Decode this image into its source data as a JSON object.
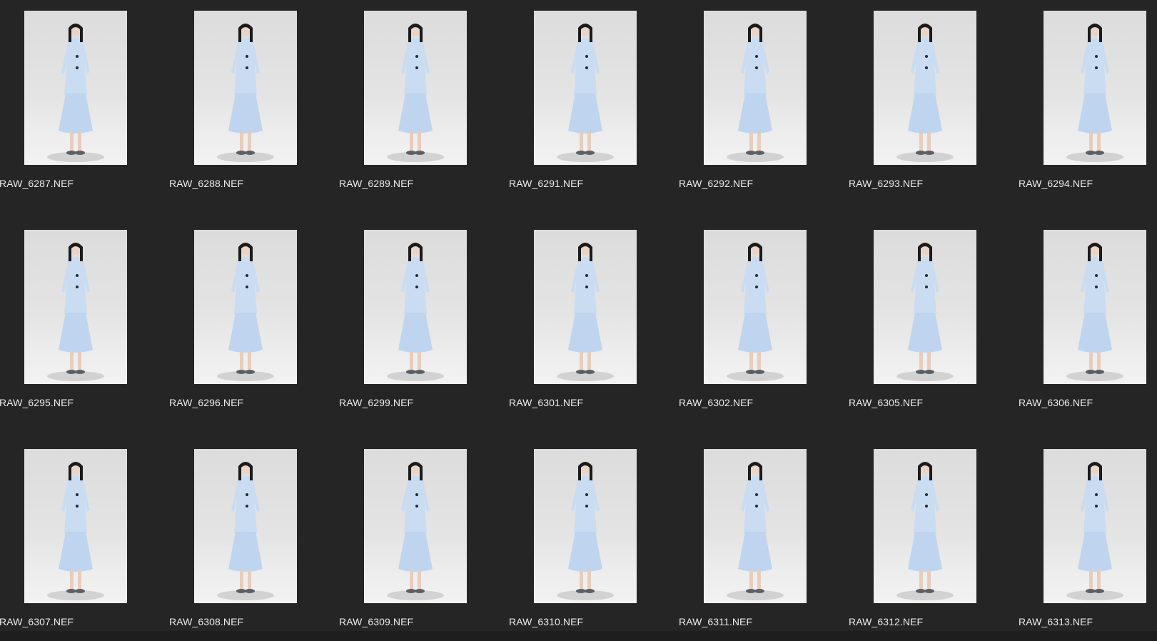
{
  "window": {
    "background": "#252526",
    "label_color": "#ececec"
  },
  "photos": [
    {
      "filename": "RAW_6287.NEF"
    },
    {
      "filename": "RAW_6288.NEF"
    },
    {
      "filename": "RAW_6289.NEF"
    },
    {
      "filename": "RAW_6291.NEF"
    },
    {
      "filename": "RAW_6292.NEF"
    },
    {
      "filename": "RAW_6293.NEF"
    },
    {
      "filename": "RAW_6294.NEF"
    },
    {
      "filename": "RAW_6295.NEF"
    },
    {
      "filename": "RAW_6296.NEF"
    },
    {
      "filename": "RAW_6299.NEF"
    },
    {
      "filename": "RAW_6301.NEF"
    },
    {
      "filename": "RAW_6302.NEF"
    },
    {
      "filename": "RAW_6305.NEF"
    },
    {
      "filename": "RAW_6306.NEF"
    },
    {
      "filename": "RAW_6307.NEF"
    },
    {
      "filename": "RAW_6308.NEF"
    },
    {
      "filename": "RAW_6309.NEF"
    },
    {
      "filename": "RAW_6310.NEF"
    },
    {
      "filename": "RAW_6311.NEF"
    },
    {
      "filename": "RAW_6312.NEF"
    },
    {
      "filename": "RAW_6313.NEF"
    }
  ]
}
